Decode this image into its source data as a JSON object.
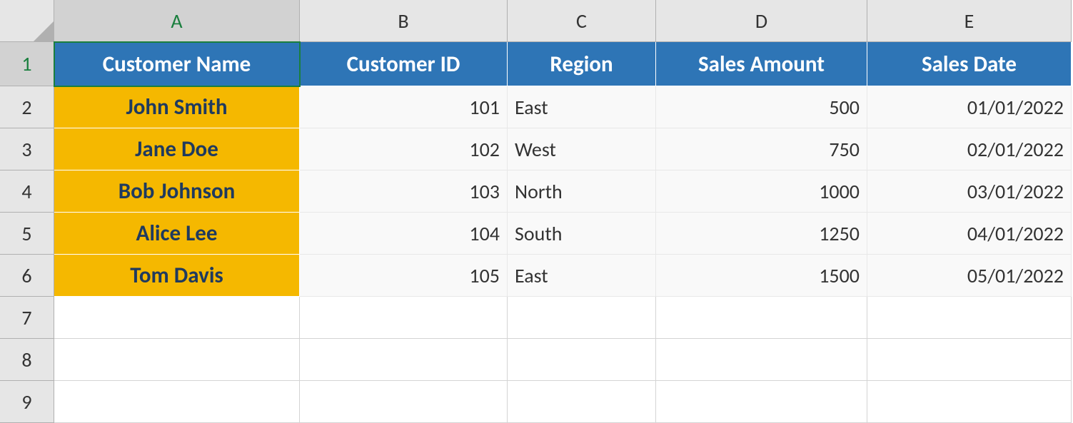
{
  "columns": [
    "A",
    "B",
    "C",
    "D",
    "E"
  ],
  "rows": [
    "1",
    "2",
    "3",
    "4",
    "5",
    "6",
    "7",
    "8",
    "9"
  ],
  "headers": {
    "customer_name": "Customer Name",
    "customer_id": "Customer ID",
    "region": "Region",
    "sales_amount": "Sales Amount",
    "sales_date": "Sales Date"
  },
  "data": [
    {
      "name": "John Smith",
      "id": "101",
      "region": "East",
      "amount": "500",
      "date": "01/01/2022"
    },
    {
      "name": "Jane Doe",
      "id": "102",
      "region": "West",
      "amount": "750",
      "date": "02/01/2022"
    },
    {
      "name": "Bob Johnson",
      "id": "103",
      "region": "North",
      "amount": "1000",
      "date": "03/01/2022"
    },
    {
      "name": "Alice Lee",
      "id": "104",
      "region": "South",
      "amount": "1250",
      "date": "04/01/2022"
    },
    {
      "name": "Tom Davis",
      "id": "105",
      "region": "East",
      "amount": "1500",
      "date": "05/01/2022"
    }
  ],
  "selected_cell": "A1"
}
